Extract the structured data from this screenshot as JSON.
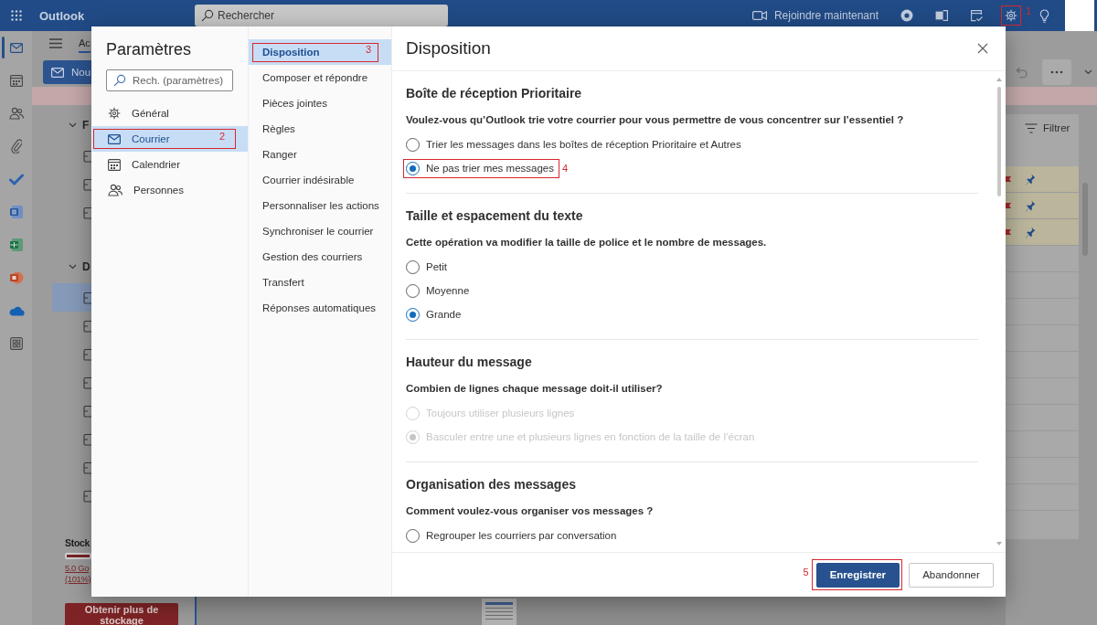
{
  "top_bar": {
    "app_name": "Outlook",
    "search": {
      "placeholder": "Rechercher"
    },
    "join_button": "Rejoindre maintenant",
    "settings_annotation": "1"
  },
  "app_rail": {
    "items": [
      {
        "selected": true
      },
      {
        "selected": false
      },
      {
        "selected": false
      },
      {
        "selected": false
      },
      {
        "selected": false
      },
      {
        "selected": false
      },
      {
        "selected": false
      },
      {
        "selected": false
      },
      {
        "selected": false
      },
      {
        "selected": false
      }
    ]
  },
  "ribbon": {
    "tabs": [
      {
        "label": "Ac",
        "selected": true
      }
    ],
    "new_button": "Nou"
  },
  "folder_pane": {
    "sections": [
      {
        "label": "F",
        "expanded": true,
        "folders": [
          {
            "selected": false
          },
          {
            "selected": false
          },
          {
            "selected": false
          }
        ]
      },
      {
        "label": "D",
        "expanded": true,
        "folders": [
          {
            "selected": true
          },
          {
            "selected": false
          },
          {
            "selected": false
          },
          {
            "selected": false
          },
          {
            "selected": false
          },
          {
            "selected": false
          },
          {
            "selected": false
          },
          {
            "selected": false
          }
        ]
      }
    ],
    "storage": {
      "title": "Stock",
      "level": 1,
      "usage_lines": [
        "5.0 Go",
        "(101%)"
      ],
      "button": "Obtenir plus de stockage"
    }
  },
  "message_list": {
    "filter_button": "Filtrer",
    "rows": [
      {
        "pinned": true,
        "flagged": true
      },
      {
        "pinned": true,
        "flagged": true
      },
      {
        "pinned": true,
        "flagged": true
      },
      {
        "pinned": false,
        "flagged": false
      },
      {
        "pinned": false,
        "flagged": false
      },
      {
        "pinned": false,
        "flagged": false
      },
      {
        "pinned": false,
        "flagged": false
      },
      {
        "pinned": false,
        "flagged": false
      },
      {
        "pinned": false,
        "flagged": false
      },
      {
        "pinned": false,
        "flagged": false
      },
      {
        "pinned": false,
        "flagged": false
      },
      {
        "pinned": false,
        "flagged": false
      },
      {
        "pinned": false,
        "flagged": false
      }
    ]
  },
  "settings_dialog": {
    "title": "Paramètres",
    "search": {
      "placeholder": "Rech. (paramètres)"
    },
    "categories": [
      {
        "label": "Général",
        "selected": false
      },
      {
        "label": "Courrier",
        "selected": true,
        "annotation": "2"
      },
      {
        "label": "Calendrier",
        "selected": false
      },
      {
        "label": "Personnes",
        "selected": false
      }
    ],
    "subcategories": [
      {
        "label": "Disposition",
        "selected": true,
        "annotation": "3"
      },
      {
        "label": "Composer et répondre",
        "selected": false
      },
      {
        "label": "Pièces jointes",
        "selected": false
      },
      {
        "label": "Règles",
        "selected": false
      },
      {
        "label": "Ranger",
        "selected": false
      },
      {
        "label": "Courrier indésirable",
        "selected": false
      },
      {
        "label": "Personnaliser les actions",
        "selected": false
      },
      {
        "label": "Synchroniser le courrier",
        "selected": false
      },
      {
        "label": "Gestion des courriers",
        "selected": false
      },
      {
        "label": "Transfert",
        "selected": false
      },
      {
        "label": "Réponses automatiques",
        "selected": false
      }
    ],
    "panel": {
      "title": "Disposition",
      "sections": [
        {
          "title": "Boîte de réception Prioritaire",
          "question": "Voulez-vous qu’Outlook trie votre courrier pour vous permettre de vous concentrer sur l’essentiel ?",
          "options": [
            {
              "label": "Trier les messages dans les boîtes de réception Prioritaire et Autres",
              "selected": false,
              "disabled": false
            },
            {
              "label": "Ne pas trier mes messages",
              "selected": true,
              "disabled": false,
              "annotation": "4"
            }
          ]
        },
        {
          "title": "Taille et espacement du texte",
          "question": "Cette opération va modifier la taille de police et le nombre de messages.",
          "options": [
            {
              "label": "Petit",
              "selected": false,
              "disabled": false
            },
            {
              "label": "Moyenne",
              "selected": false,
              "disabled": false
            },
            {
              "label": "Grande",
              "selected": true,
              "disabled": false
            }
          ]
        },
        {
          "title": "Hauteur du message",
          "question": "Combien de lignes chaque message doit-il utiliser?",
          "options": [
            {
              "label": "Toujours utiliser plusieurs lignes",
              "selected": false,
              "disabled": true
            },
            {
              "label": "Basculer entre une et plusieurs lignes en fonction de la taille de l’écran",
              "selected": true,
              "disabled": true
            }
          ]
        },
        {
          "title": "Organisation des messages",
          "question": "Comment voulez-vous organiser vos messages ?",
          "options": [
            {
              "label": "Regrouper les courriers par conversation",
              "selected": false,
              "disabled": false
            }
          ]
        }
      ]
    },
    "buttons": [
      {
        "label": "Enregistrer",
        "kind": "primary",
        "annotation": "5"
      },
      {
        "label": "Abandonner",
        "kind": "secondary"
      }
    ]
  }
}
